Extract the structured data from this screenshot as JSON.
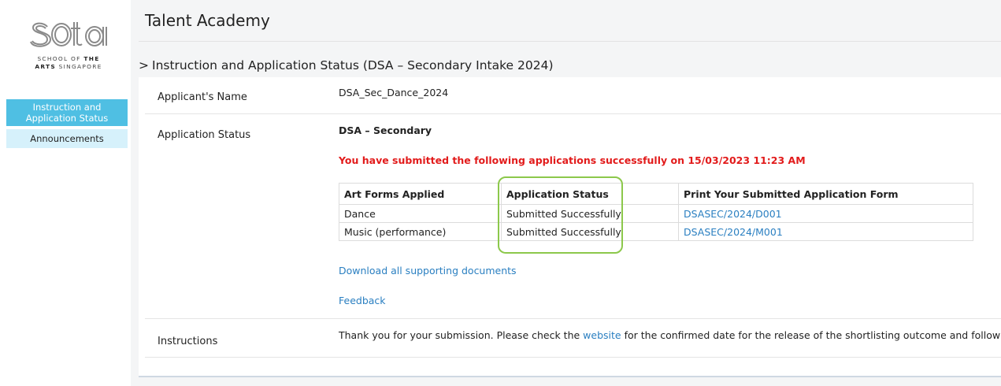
{
  "logo": {
    "text": "sota",
    "line1_a": "SCHOOL OF ",
    "line1_b": "THE",
    "line2_a": "ARTS",
    "line2_b": " SINGAPORE"
  },
  "sidebar": {
    "items": [
      {
        "label": "Instruction and Application Status",
        "active": true
      },
      {
        "label": "Announcements",
        "active": false
      }
    ]
  },
  "header": {
    "title": "Talent Academy",
    "breadcrumb_caret": ">",
    "section_title": "Instruction and Application Status (DSA – Secondary Intake 2024)"
  },
  "details": {
    "applicant_label": "Applicant's Name",
    "applicant_value": "DSA_Sec_Dance_2024",
    "status_label": "Application Status",
    "status_heading": "DSA – Secondary",
    "success_message": "You have submitted the following applications successfully on 15/03/2023 11:23 AM",
    "table": {
      "headers": [
        "Art Forms Applied",
        "Application Status",
        "Print Your Submitted Application Form"
      ],
      "rows": [
        {
          "art_form": "Dance",
          "status": "Submitted Successfully",
          "form_link": "DSASEC/2024/D001"
        },
        {
          "art_form": "Music (performance)",
          "status": "Submitted Successfully",
          "form_link": "DSASEC/2024/M001"
        }
      ]
    },
    "download_link": "Download all supporting documents",
    "feedback_link": "Feedback",
    "instructions_label": "Instructions",
    "instructions_text_a": "Thank you for your submission. Please check the ",
    "instructions_link": "website",
    "instructions_text_b": " for the confirmed date for the release of the shortlisting outcome and follow up"
  },
  "colors": {
    "accent": "#4fbfe3",
    "nav_secondary": "#d6f1fb",
    "error_red": "#e21b1b",
    "link_blue": "#2a7fc1",
    "highlight_green": "#8cc84b"
  }
}
